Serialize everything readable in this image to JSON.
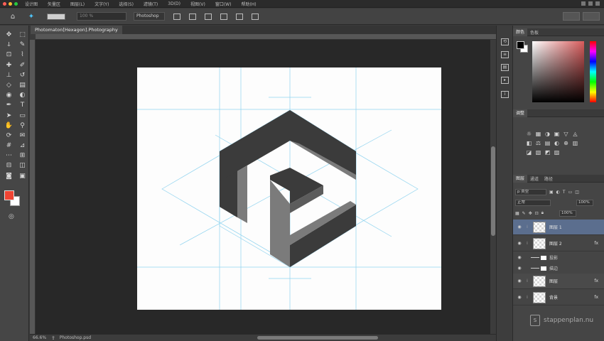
{
  "menubar": {
    "items": [
      "设计图",
      "矢量区",
      "图层(L)",
      "文字(Y)",
      "选择(S)",
      "滤镜(T)",
      "3D(D)",
      "视图(V)",
      "窗口(W)",
      "帮助(H)"
    ]
  },
  "options": {
    "field_value": "100 %",
    "dropdown_value": "Photoshop"
  },
  "document": {
    "tab_title": "Photomaton[Hexagon].Photography",
    "zoom": "66.6%",
    "doc_info": "Photoshop.psd"
  },
  "panels": {
    "color_tabs": [
      "颜色",
      "色板"
    ],
    "adjustments_title": "调整",
    "adjustment_icons": [
      "☼",
      "▦",
      "◑",
      "▣",
      "▽",
      "◬",
      "◧",
      "⚖",
      "▤",
      "◐",
      "⊕",
      "▥",
      "◪",
      "▧",
      "◩",
      "▨",
      "◫",
      "▩"
    ],
    "layers_tabs": [
      "图层",
      "通道",
      "路径"
    ],
    "layers_kind": "p 类型",
    "layers_blend": "正常",
    "layers_opacity": "100%",
    "layers_fill": "100%",
    "layers": [
      {
        "name": "图层 1",
        "selected": true,
        "fx": false
      },
      {
        "name": "图层 2",
        "selected": false,
        "fx": true
      },
      {
        "name": "投影",
        "sub": true
      },
      {
        "name": "描边",
        "sub": true
      },
      {
        "name": "图层",
        "selected": false,
        "fx": true,
        "grouped": true
      },
      {
        "name": "背景",
        "selected": false,
        "fx": true
      }
    ]
  },
  "watermark": "stappenplan.nu",
  "colors": {
    "foreground": "#f04433",
    "background": "#ffffff",
    "guide": "#8fd3ef",
    "shape_dark": "#3b3b3b",
    "shape_mid": "#7b7b7b",
    "selected_layer": "#5b6e8e"
  }
}
